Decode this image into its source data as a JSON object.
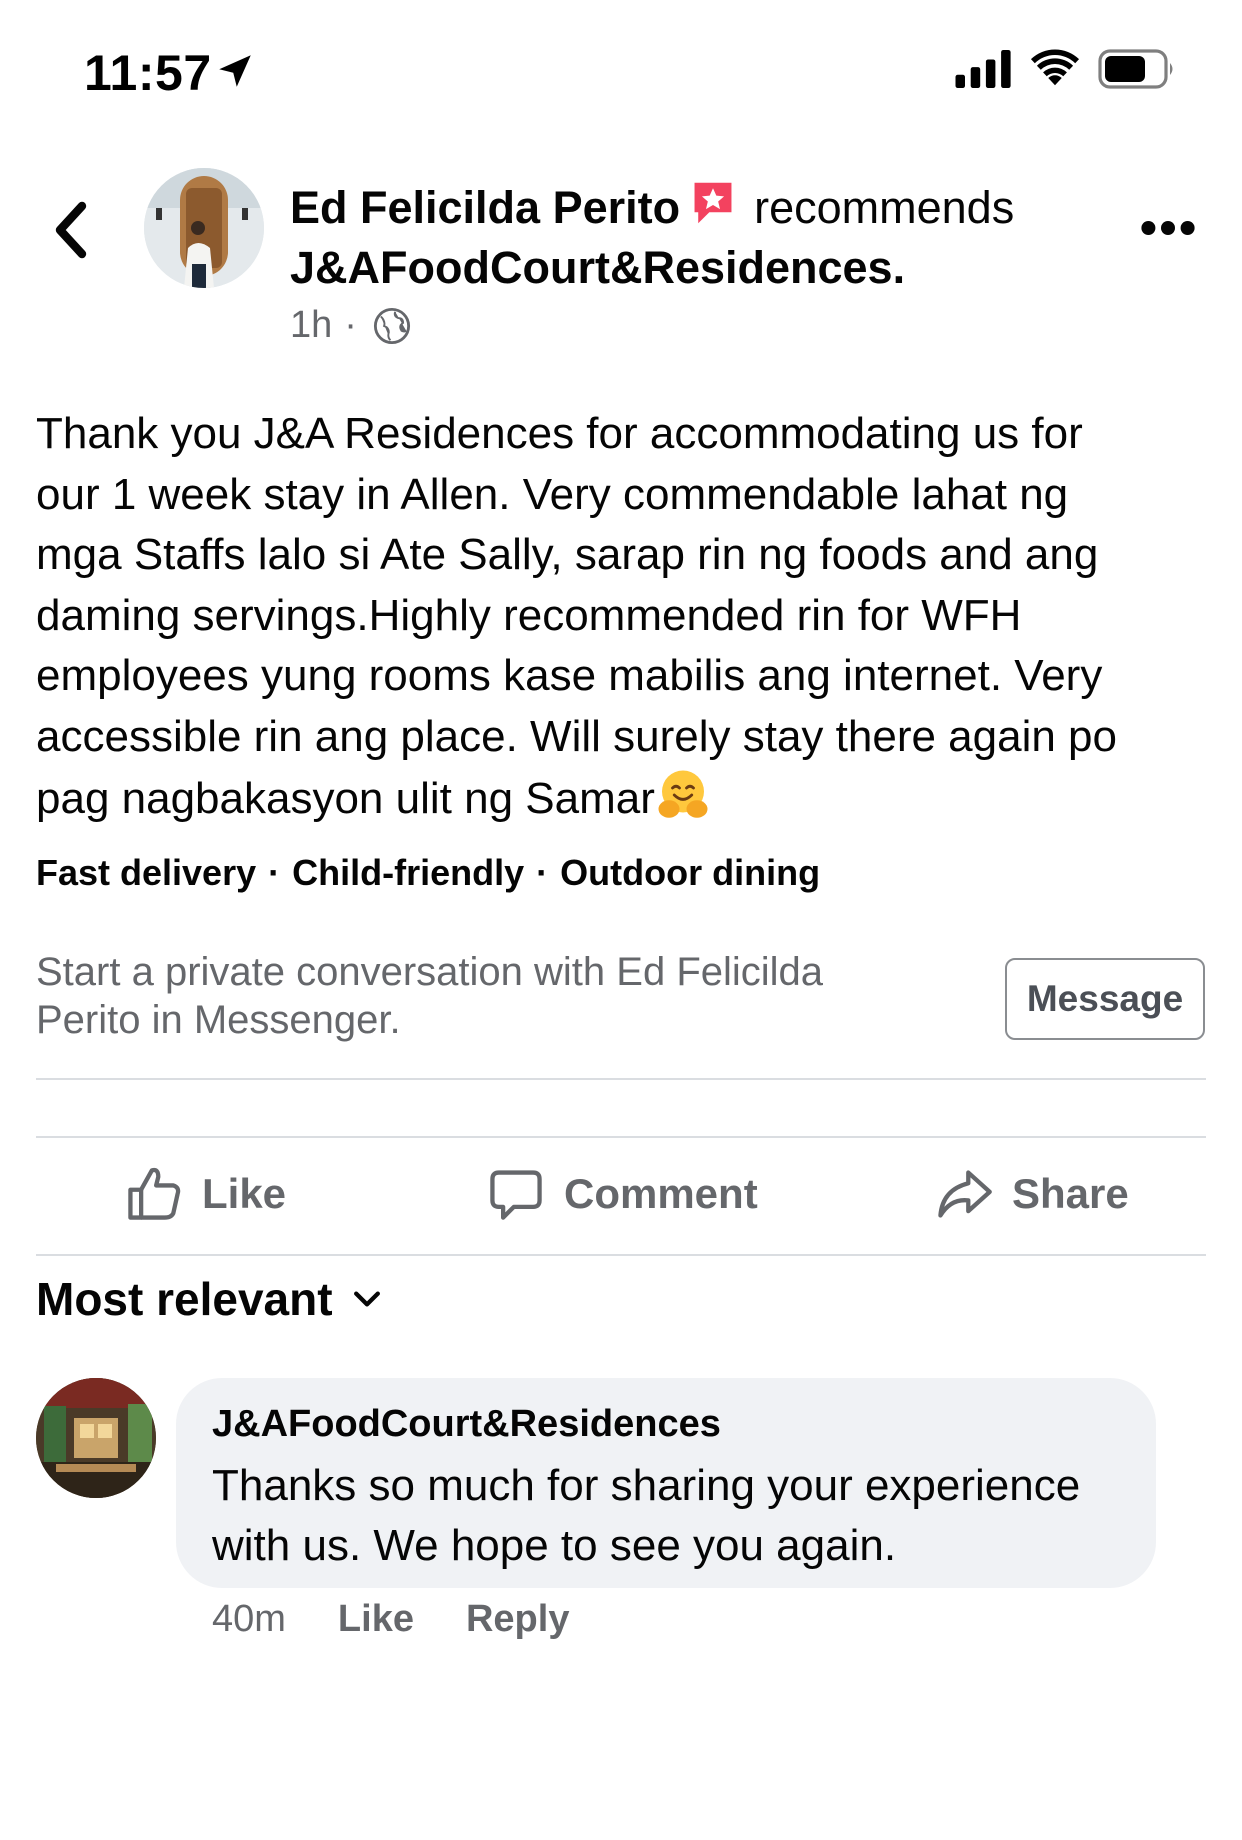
{
  "status_bar": {
    "time": "11:57"
  },
  "post": {
    "author": "Ed Felicilda Perito",
    "verb": "recommends",
    "page": "J&AFoodCourt&Residences.",
    "age": "1h",
    "separator": "·",
    "body": "Thank you J&A Residences for accommodating us for\nour 1 week stay in Allen. Very commendable lahat ng\nmga Staffs lalo si Ate Sally, sarap rin ng foods and ang\ndaming servings.Highly recommended rin for WFH\nemployees yung rooms kase mabilis ang internet.  Very\naccessible rin ang place. Will surely stay there again po\npag nagbakasyon ulit ng Samar",
    "tags": [
      "Fast delivery",
      "Child-friendly",
      "Outdoor dining"
    ],
    "tag_separator": "·"
  },
  "messenger_prompt": {
    "text": "Start a private conversation with Ed Felicilda Perito in Messenger.",
    "button_label": "Message"
  },
  "actions": {
    "like": "Like",
    "comment": "Comment",
    "share": "Share"
  },
  "sort": {
    "label": "Most relevant"
  },
  "comment": {
    "author": "J&AFoodCourt&Residences",
    "text": "Thanks so much for sharing your experience with us. We hope to see you again.",
    "age": "40m",
    "like_label": "Like",
    "reply_label": "Reply"
  },
  "colors": {
    "text": "#050505",
    "secondary": "#65676b",
    "bubble": "#f0f2f5",
    "badge": "#f3425f"
  }
}
